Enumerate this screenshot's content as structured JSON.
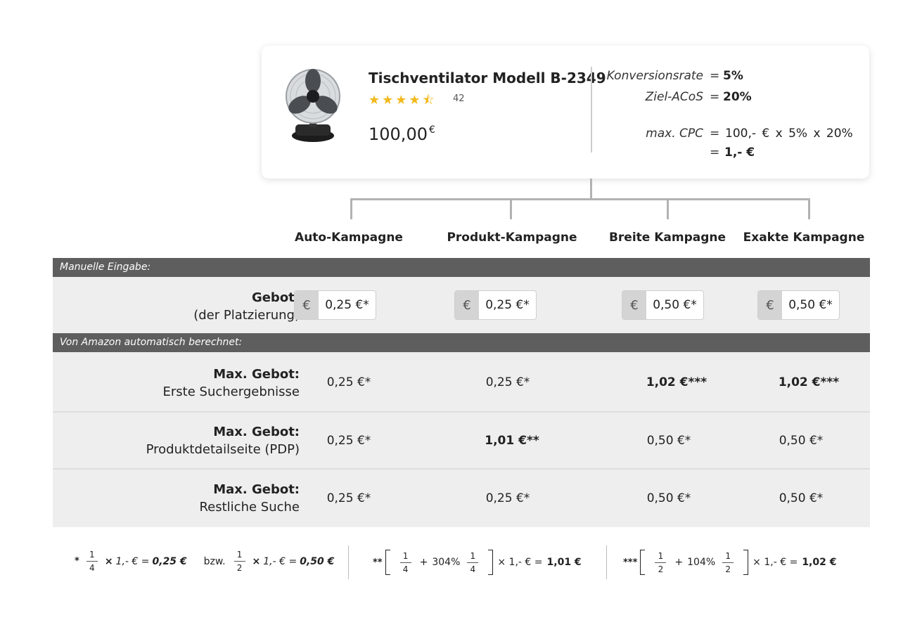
{
  "product": {
    "title": "Tischventilator Modell B-2349",
    "stars": "★★★★⯪",
    "rating_count": "42",
    "price": "100,00",
    "price_currency": "€"
  },
  "formula": {
    "conversion_label": "Konversionsrate",
    "conversion_eq": "=",
    "conversion_value": "5%",
    "acos_label": "Ziel-ACoS",
    "acos_eq": "=",
    "acos_value": "20%",
    "cpc_label": "max. CPC",
    "cpc_eq": "=",
    "cpc_expr": "100,- € x 5% x 20%",
    "cpc_eq2": "=",
    "cpc_result": "1,- €"
  },
  "columns": [
    "Auto-Kampagne",
    "Produkt-Kampagne",
    "Breite Kampagne",
    "Exakte Kampagne"
  ],
  "sections": {
    "manual": "Manuelle Eingabe:",
    "auto": "Von Amazon automatisch berechnet:"
  },
  "bid_row": {
    "label_bold": "Gebot:",
    "label_sub": "(der Platzierung)",
    "currency_symbol": "€",
    "inputs": [
      "0,25 €*",
      "0,25 €*",
      "0,50 €*",
      "0,50 €*"
    ]
  },
  "rows": [
    {
      "label_bold": "Max. Gebot:",
      "label_sub": "Erste Suchergebnisse",
      "values": [
        "0,25 €*",
        "0,25 €*",
        "1,02 €***",
        "1,02 €***"
      ]
    },
    {
      "label_bold": "Max. Gebot:",
      "label_sub": "Produktdetailseite (PDP)",
      "values": [
        "0,25 €*",
        "1,01 €**",
        "0,50 €*",
        "0,50 €*"
      ]
    },
    {
      "label_bold": "Max. Gebot:",
      "label_sub": "Restliche Suche",
      "values": [
        "0,25 €*",
        "0,25 €*",
        "0,50 €*",
        "0,50 €*"
      ]
    }
  ],
  "footnotes": {
    "f1": {
      "mark": "*",
      "num1": "1",
      "den1": "4",
      "times": "×",
      "base": "1,- € =",
      "res1": "0,25 €",
      "bzw": "bzw.",
      "num2": "1",
      "den2": "2",
      "res2": "0,50 €"
    },
    "f2": {
      "mark": "**",
      "num1": "1",
      "den1": "4",
      "plus": "+",
      "pct": "304%",
      "num2": "1",
      "den2": "4",
      "tail": "× 1,- € =",
      "res": "1,01 €"
    },
    "f3": {
      "mark": "***",
      "num1": "1",
      "den1": "2",
      "plus": "+",
      "pct": "104%",
      "num2": "1",
      "den2": "2",
      "tail": "× 1,- € =",
      "res": "1,02 €"
    }
  },
  "colors": {
    "band": "#5e5e5e",
    "row_bg": "#eeeeee",
    "star": "#f2b91c",
    "tree_line": "#b2b2b2"
  }
}
